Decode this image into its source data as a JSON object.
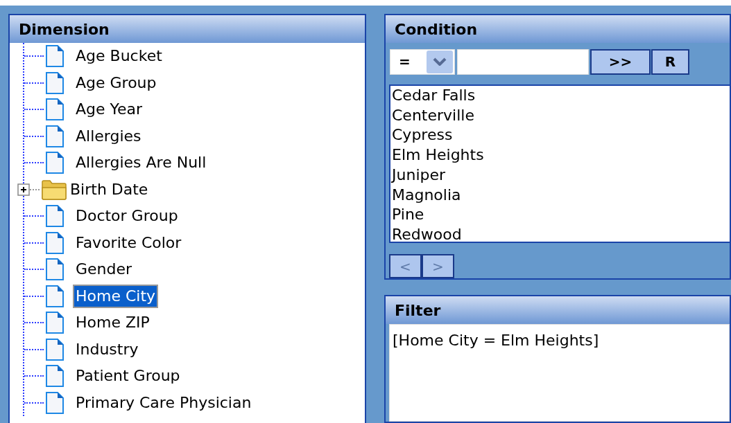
{
  "dimension": {
    "title": "Dimension",
    "items": [
      {
        "label": "Age Bucket",
        "kind": "leaf",
        "selected": false
      },
      {
        "label": "Age Group",
        "kind": "leaf",
        "selected": false
      },
      {
        "label": "Age Year",
        "kind": "leaf",
        "selected": false
      },
      {
        "label": "Allergies",
        "kind": "leaf",
        "selected": false
      },
      {
        "label": "Allergies Are Null",
        "kind": "leaf",
        "selected": false
      },
      {
        "label": "Birth Date",
        "kind": "folder",
        "expanded": false,
        "selected": false
      },
      {
        "label": "Doctor Group",
        "kind": "leaf",
        "selected": false
      },
      {
        "label": "Favorite Color",
        "kind": "leaf",
        "selected": false
      },
      {
        "label": "Gender",
        "kind": "leaf",
        "selected": false
      },
      {
        "label": "Home City",
        "kind": "leaf",
        "selected": true
      },
      {
        "label": "Home ZIP",
        "kind": "leaf",
        "selected": false
      },
      {
        "label": "Industry",
        "kind": "leaf",
        "selected": false
      },
      {
        "label": "Patient Group",
        "kind": "leaf",
        "selected": false
      },
      {
        "label": "Primary Care Physician",
        "kind": "leaf",
        "selected": false
      }
    ]
  },
  "condition": {
    "title": "Condition",
    "operator": "=",
    "buttons": [
      ">>",
      "R"
    ],
    "values": [
      "Cedar Falls",
      "Centerville",
      "Cypress",
      "Elm Heights",
      "Juniper",
      "Magnolia",
      "Pine",
      "Redwood"
    ],
    "pager": [
      {
        "label": "<",
        "disabled": true
      },
      {
        "label": ">",
        "disabled": true
      }
    ]
  },
  "filter": {
    "title": "Filter",
    "text": "[Home City = Elm Heights]"
  }
}
